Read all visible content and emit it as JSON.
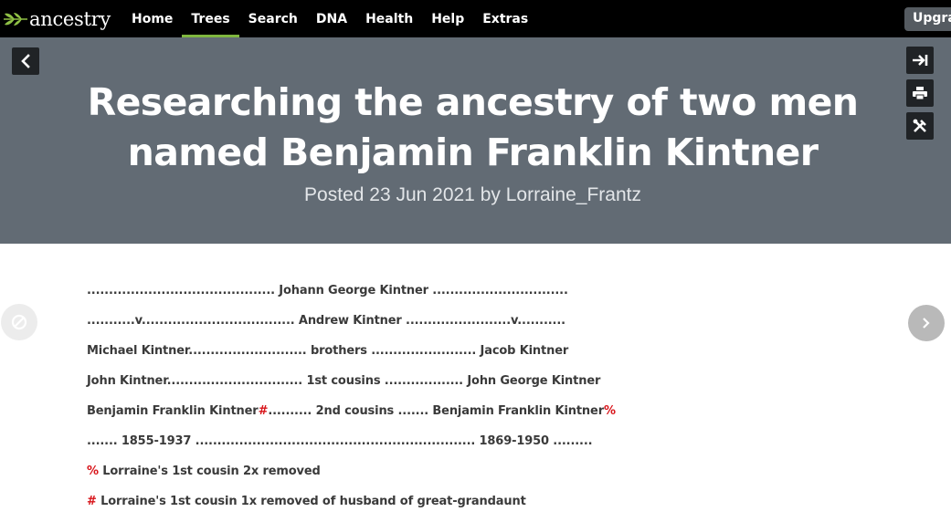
{
  "brand": {
    "name": "ancestry"
  },
  "nav": {
    "items": [
      {
        "label": "Home",
        "active": false
      },
      {
        "label": "Trees",
        "active": true
      },
      {
        "label": "Search",
        "active": false
      },
      {
        "label": "DNA",
        "active": false
      },
      {
        "label": "Health",
        "active": false
      },
      {
        "label": "Help",
        "active": false
      },
      {
        "label": "Extras",
        "active": false
      }
    ],
    "upgrade_label": "Upgra"
  },
  "header": {
    "title": "Researching the ancestry of two men named Benjamin Franklin Kintner",
    "byline": "Posted 23 Jun 2021 by Lorraine_Frantz"
  },
  "tools": {
    "back_icon": "chevron-left-icon",
    "items": [
      "collapse-to-right-icon",
      "print-icon",
      "tools-icon"
    ]
  },
  "content": {
    "line1": "........................................... Johann George Kintner ...............................",
    "line2": "...........v................................... Andrew Kintner ........................v...........",
    "line3": "Michael Kintner........................... brothers ........................ Jacob Kintner",
    "line4": "John Kintner............................... 1st cousins .................. John George Kintner",
    "line5": {
      "left_name": "Benjamin Franklin Kintner",
      "left_marker": "#",
      "middle": ".......... 2nd cousins ....... Benjamin Franklin Kintner",
      "right_marker": "%"
    },
    "line6": "....... 1855-1937 ................................................................ 1869-1950 .........",
    "footnote1": {
      "marker": "%",
      "text": " Lorraine's 1st cousin 2x removed"
    },
    "footnote2": {
      "marker": "#",
      "text": " Lorraine's 1st cousin 1x removed of husband of great-grandaunt"
    }
  },
  "colors": {
    "topbar": "#000000",
    "hero": "#626b74",
    "accent": "#7fb63f",
    "marker": "#d8141a"
  }
}
